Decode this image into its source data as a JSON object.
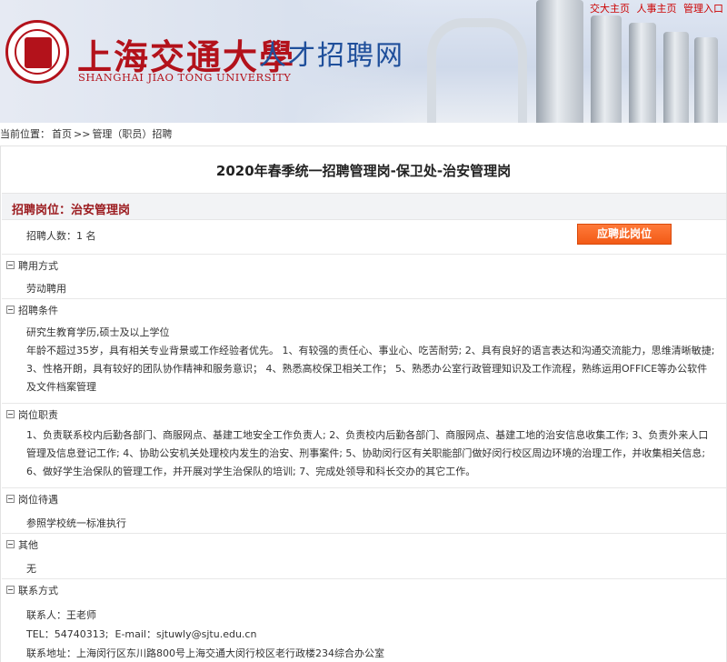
{
  "header": {
    "logo_cn": "上海交通大學",
    "logo_en": "SHANGHAI JIAO TONG UNIVERSITY",
    "logo_sub": "人才招聘网",
    "top_links": [
      "交大主页",
      "人事主页",
      "管理入口"
    ]
  },
  "breadcrumb": {
    "label": "当前位置：",
    "home": "首页",
    "sep": ">>",
    "current": "管理（职员）招聘"
  },
  "job": {
    "title": "2020年春季统一招聘管理岗-保卫处-治安管理岗",
    "position_label": "招聘岗位：治安管理岗",
    "headcount": "招聘人数：1 名",
    "apply_button": "应聘此岗位"
  },
  "sections": {
    "employment": {
      "title": "聘用方式",
      "content": "劳动聘用"
    },
    "conditions": {
      "title": "招聘条件",
      "line1": "研究生教育学历,硕士及以上学位",
      "line2": "年龄不超过35岁，具有相关专业背景或工作经验者优先。 1、有较强的责任心、事业心、吃苦耐劳; 2、具有良好的语言表达和沟通交流能力，思维清晰敏捷; 3、性格开朗，具有较好的团队协作精神和服务意识； 4、熟悉高校保卫相关工作； 5、熟悉办公室行政管理知识及工作流程，熟练运用OFFICE等办公软件及文件档案管理"
    },
    "duties": {
      "title": "岗位职责",
      "content": "1、负责联系校内后勤各部门、商服网点、基建工地安全工作负责人; 2、负责校内后勤各部门、商服网点、基建工地的治安信息收集工作; 3、负责外来人口管理及信息登记工作; 4、协助公安机关处理校内发生的治安、刑事案件; 5、协助闵行区有关职能部门做好闵行校区周边环境的治理工作，并收集相关信息; 6、做好学生治保队的管理工作，并开展对学生治保队的培训; 7、完成处领导和科长交办的其它工作。"
    },
    "treatment": {
      "title": "岗位待遇",
      "content": "参照学校统一标准执行"
    },
    "other": {
      "title": "其他",
      "content": "无"
    },
    "contact": {
      "title": "联系方式",
      "person": "联系人：王老师",
      "tel_label": "TEL：54740313;",
      "email_label": "E-mail：sjtuwly@sjtu.edu.cn",
      "address": "联系地址：上海闵行区东川路800号上海交通大闵行校区老行政楼234综合办公室"
    }
  },
  "colors": {
    "brand_red": "#b3121b",
    "label_red": "#9b1a1e",
    "button_orange": "#f25a16"
  }
}
